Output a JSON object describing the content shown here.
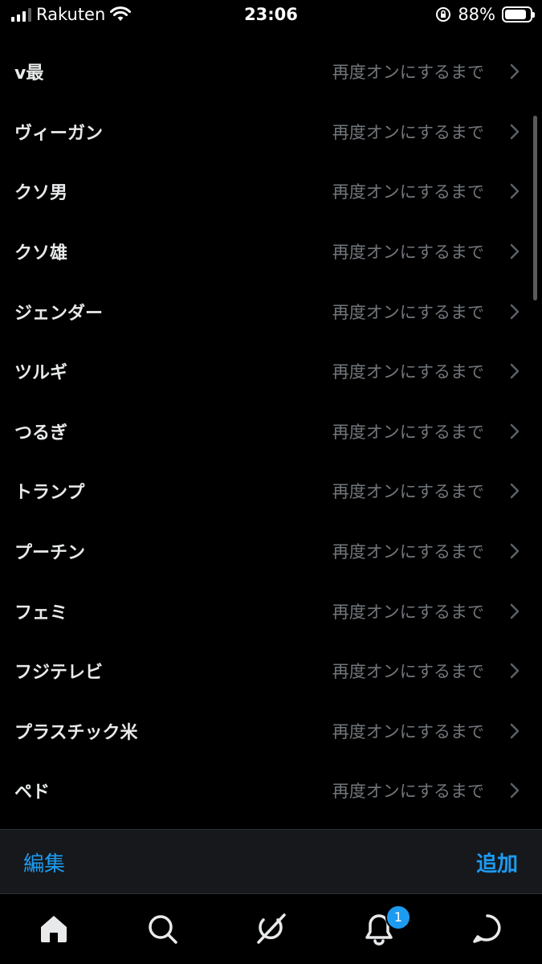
{
  "status_bar": {
    "carrier": "Rakuten",
    "time": "23:06",
    "battery": "88%",
    "battery_level": 0.88
  },
  "muted_words": [
    {
      "word": "v最",
      "until": "再度オンにするまで"
    },
    {
      "word": "ヴィーガン",
      "until": "再度オンにするまで"
    },
    {
      "word": "クソ男",
      "until": "再度オンにするまで"
    },
    {
      "word": "クソ雄",
      "until": "再度オンにするまで"
    },
    {
      "word": "ジェンダー",
      "until": "再度オンにするまで"
    },
    {
      "word": "ツルギ",
      "until": "再度オンにするまで"
    },
    {
      "word": "つるぎ",
      "until": "再度オンにするまで"
    },
    {
      "word": "トランプ",
      "until": "再度オンにするまで"
    },
    {
      "word": "プーチン",
      "until": "再度オンにするまで"
    },
    {
      "word": "フェミ",
      "until": "再度オンにするまで"
    },
    {
      "word": "フジテレビ",
      "until": "再度オンにするまで"
    },
    {
      "word": "プラスチック米",
      "until": "再度オンにするまで"
    },
    {
      "word": "ペド",
      "until": "再度オンにするまで"
    }
  ],
  "toolbar": {
    "edit_label": "編集",
    "add_label": "追加"
  },
  "tab_bar": {
    "tabs": [
      "home-icon",
      "search-icon",
      "grok-icon",
      "notifications-icon",
      "messages-icon"
    ],
    "notification_count": "1"
  },
  "colors": {
    "accent": "#1d9bf0",
    "background": "#000000",
    "secondary_text": "#71767b"
  }
}
